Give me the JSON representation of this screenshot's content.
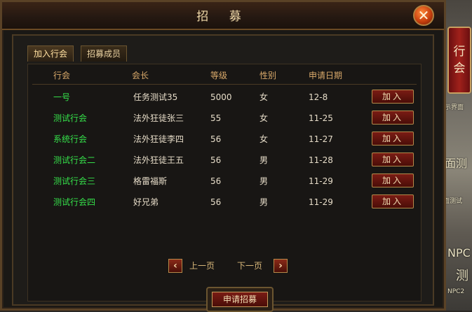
{
  "window": {
    "title": "招 募",
    "close_glyph": "✕"
  },
  "tabs": [
    {
      "label": "加入行会",
      "active": true
    },
    {
      "label": "招募成员",
      "active": false
    }
  ],
  "table": {
    "headers": [
      "行会",
      "会长",
      "等级",
      "性别",
      "申请日期"
    ],
    "rows": [
      {
        "guild": "一号",
        "leader": "任务测试35",
        "level": "5000",
        "gender": "女",
        "date": "12-8",
        "action": "加入"
      },
      {
        "guild": "测试行会",
        "leader": "法外狂徒张三",
        "level": "55",
        "gender": "女",
        "date": "11-25",
        "action": "加入"
      },
      {
        "guild": "系统行会",
        "leader": "法外狂徒李四",
        "level": "56",
        "gender": "女",
        "date": "11-27",
        "action": "加入"
      },
      {
        "guild": "测试行会二",
        "leader": "法外狂徒王五",
        "level": "56",
        "gender": "男",
        "date": "11-28",
        "action": "加入"
      },
      {
        "guild": "测试行会三",
        "leader": "格雷福斯",
        "level": "56",
        "gender": "男",
        "date": "11-29",
        "action": "加入"
      },
      {
        "guild": "测试行会四",
        "leader": "好兄弟",
        "level": "56",
        "gender": "男",
        "date": "11-29",
        "action": "加入"
      }
    ]
  },
  "pager": {
    "prev": "上一页",
    "next": "下一页"
  },
  "apply_button": "申请招募",
  "side": {
    "guild_tab": "行会",
    "fragments": [
      "示界面",
      "面测",
      "面测试",
      "NPC",
      "测",
      "NPC2"
    ]
  },
  "colors": {
    "guild_name": "#35e04a",
    "header": "#d9a96a",
    "accent_red": "#7a1c14"
  }
}
